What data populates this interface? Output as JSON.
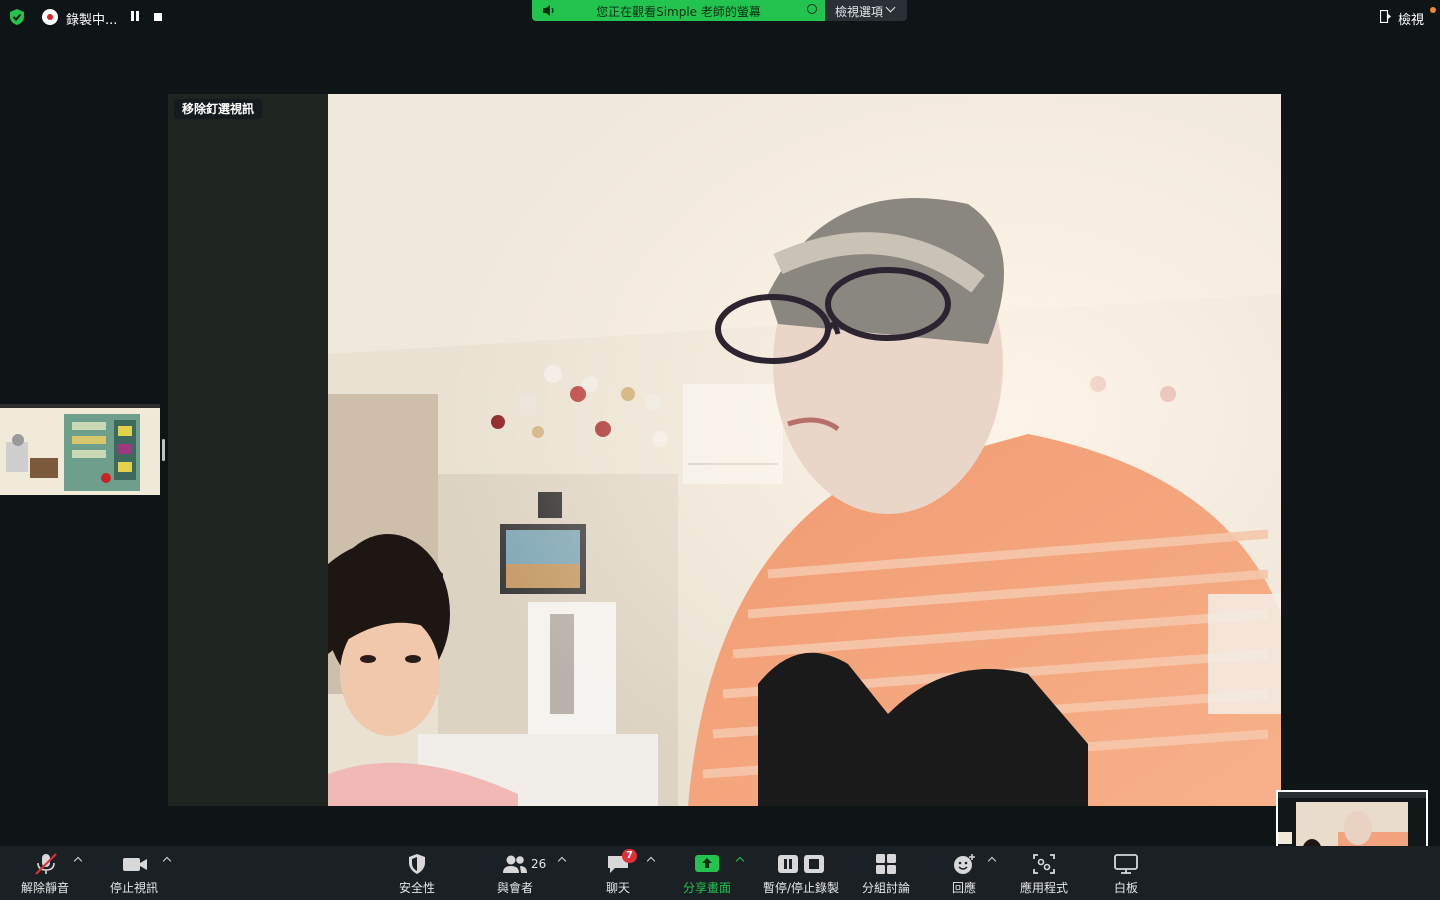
{
  "top": {
    "recording_label": "錄製中...",
    "share_banner_text": "您正在觀看Simple 老師的螢幕",
    "view_options_label": "檢視選項",
    "view_label": "檢視"
  },
  "stage": {
    "unpin_label": "移除釘選視訊"
  },
  "toolbar": {
    "unmute": "解除靜音",
    "stop_video": "停止視訊",
    "security": "安全性",
    "participants": "與會者",
    "participants_count": "26",
    "chat": "聊天",
    "chat_badge": "7",
    "share": "分享畫面",
    "pause_stop_record": "暫停/停止錄製",
    "breakout": "分組討論",
    "reactions": "回應",
    "apps": "應用程式",
    "whiteboard": "白板"
  },
  "colors": {
    "share_green": "#23c350",
    "record_red": "#e02020",
    "badge_red": "#e0303a",
    "toolbar_bg": "#1b2024"
  }
}
